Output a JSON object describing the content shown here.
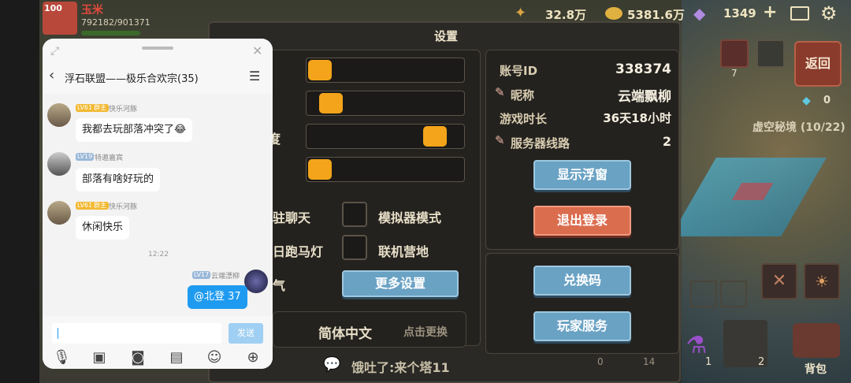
{
  "top_bar": {
    "player_name": "玉米",
    "level_badge": "100",
    "exp_text": "792182/901371",
    "wheat_value": "32.8万",
    "gold_value": "5381.6万",
    "gem_value": "1349",
    "plus_icon": "plus-icon",
    "mail_icon": "mail-icon",
    "gear_icon": "gear-icon"
  },
  "settings": {
    "title": "设置",
    "sliders": [
      {
        "label": "",
        "level": 0.0
      },
      {
        "label": "",
        "level": 0.08
      },
      {
        "label": "度",
        "level": 0.85
      },
      {
        "label": "",
        "level": 0.0
      }
    ],
    "toggles": [
      {
        "label_left": "驻聊天",
        "label_right": "模拟器模式"
      },
      {
        "label_left": "日跑马灯",
        "label_right": "联机营地"
      }
    ],
    "third_row_left": "气",
    "more_settings": "更多设置",
    "language": "简体中文",
    "language_hint": "点击更换",
    "account_id_label": "账号ID",
    "account_id_value": "338374",
    "nickname_label": "昵称",
    "nickname_value": "云端飘柳",
    "playtime_label": "游戏时长",
    "playtime_value": "36天18小时",
    "server_label": "服务器线路",
    "server_value": "2",
    "show_float_window": "显示浮窗",
    "logout": "退出登录",
    "redeem_code": "兑换码",
    "player_service": "玩家服务"
  },
  "right_side": {
    "back_button": "返回",
    "counter_7": "7",
    "crystal_count": "0",
    "area_label": "虚空秘境 (10/22)",
    "bag_label": "背包",
    "potion_count": "1",
    "scroll_count": "2",
    "slot_0": "0",
    "slot_14": "14"
  },
  "bottom_chat_text": "饿吐了:来个塔11",
  "chat": {
    "title": "浮石联盟——极乐合欢宗(35)",
    "messages": [
      {
        "level": "LV61",
        "role": "群主",
        "sender": "快乐河豚",
        "text": "我都去玩部落冲突了😂"
      },
      {
        "level": "LV19",
        "role": "",
        "sender": "特邀嘉宾",
        "text": "部落有啥好玩的"
      },
      {
        "level": "LV61",
        "role": "群主",
        "sender": "快乐河豚",
        "text": "休闲快乐"
      }
    ],
    "time_divider": "12:22",
    "self_message": {
      "level": "LV17",
      "sender": "云端漂柳",
      "text": "@北登 37"
    },
    "input_placeholder": "",
    "send_label": "发送",
    "toolbar_icons": [
      "mic-icon",
      "image-icon",
      "photo-icon",
      "file-icon",
      "emoji-icon",
      "plus-circle-icon"
    ]
  },
  "colors": {
    "accent_orange": "#f3a41a",
    "button_blue": "#6aa2c4",
    "button_red": "#db6d4f",
    "chat_bubble_self": "#1e9bf0"
  }
}
